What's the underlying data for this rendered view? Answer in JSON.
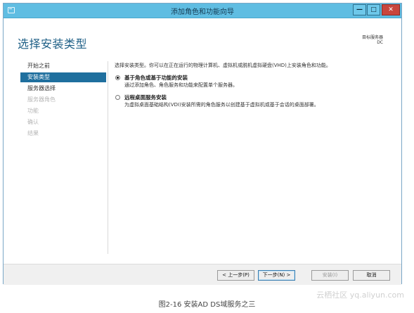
{
  "window": {
    "title": "添加角色和功能向导",
    "controls": {
      "minimize": "—",
      "maximize": "□",
      "close": "✕"
    }
  },
  "header": {
    "page_title": "选择安装类型",
    "target_label": "目标服务器",
    "target_value": "DC"
  },
  "nav": {
    "items": [
      {
        "label": "开始之前",
        "state": "normal"
      },
      {
        "label": "安装类型",
        "state": "active"
      },
      {
        "label": "服务器选择",
        "state": "normal"
      },
      {
        "label": "服务器角色",
        "state": "disabled"
      },
      {
        "label": "功能",
        "state": "disabled"
      },
      {
        "label": "确认",
        "state": "disabled"
      },
      {
        "label": "结果",
        "state": "disabled"
      }
    ]
  },
  "content": {
    "description": "选择安装类型。你可以在正在运行的物理计算机、虚拟机或脱机虚拟硬盘(VHD)上安装角色和功能。",
    "options": [
      {
        "title": "基于角色或基于功能的安装",
        "description": "通过添加角色、角色服务和功能来配置单个服务器。",
        "checked": true
      },
      {
        "title": "远程桌面服务安装",
        "description": "为虚拟桌面基础结构(VDI)安装所需的角色服务以创建基于虚拟机或基于会话的桌面部署。",
        "checked": false
      }
    ]
  },
  "footer": {
    "prev": "< 上一步(P)",
    "next": "下一步(N) >",
    "install": "安装(I)",
    "cancel": "取消"
  },
  "caption": "图2-16 安装AD DS域服务之三",
  "watermark": "云栖社区 yq.aliyun.com",
  "colors": {
    "titlebar": "#5fbde2",
    "accent": "#1f6f9e",
    "page_title": "#1e5f86"
  }
}
